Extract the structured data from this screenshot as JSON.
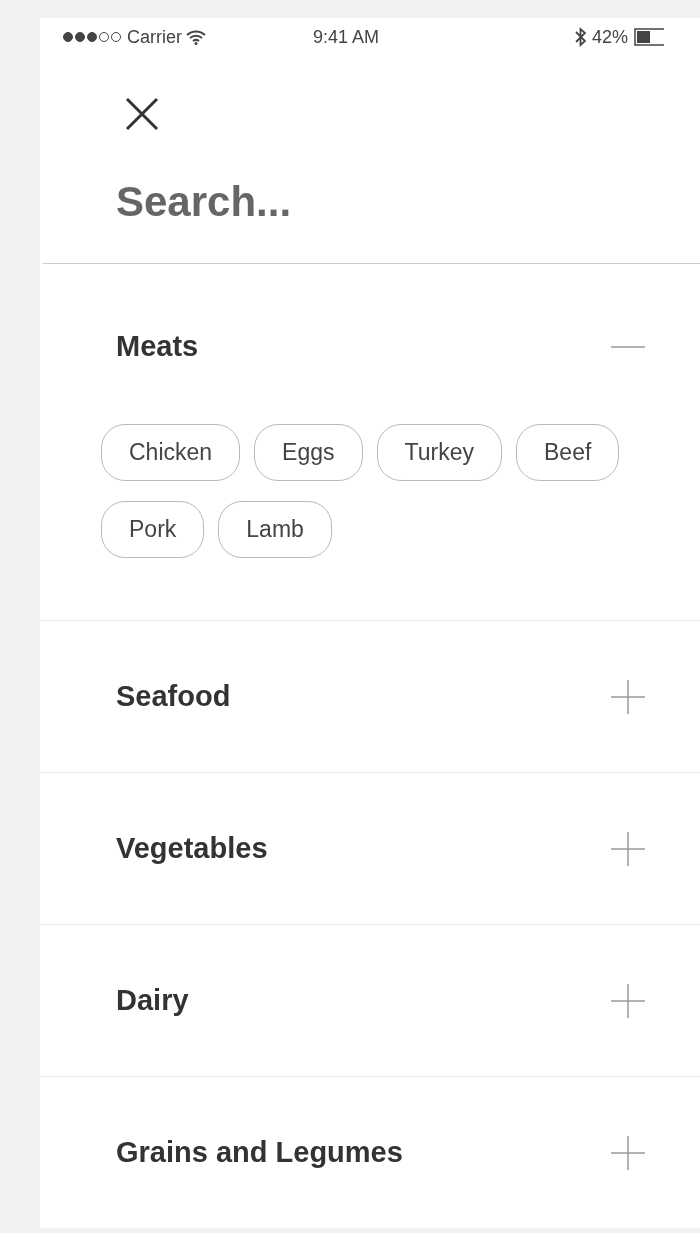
{
  "status_bar": {
    "carrier": "Carrier",
    "time": "9:41 AM",
    "battery": "42%"
  },
  "search": {
    "placeholder": "Search..."
  },
  "sections": [
    {
      "title": "Meats",
      "expanded": true,
      "chips": [
        "Chicken",
        "Eggs",
        "Turkey",
        "Beef",
        "Pork",
        "Lamb"
      ]
    },
    {
      "title": "Seafood",
      "expanded": false
    },
    {
      "title": "Vegetables",
      "expanded": false
    },
    {
      "title": "Dairy",
      "expanded": false
    },
    {
      "title": "Grains and Legumes",
      "expanded": false
    }
  ]
}
